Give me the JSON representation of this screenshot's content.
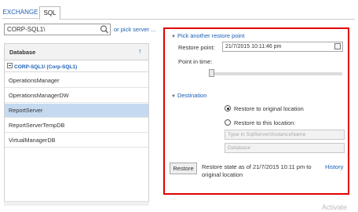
{
  "tabs": [
    {
      "label": "EXCHANGE"
    },
    {
      "label": "SQL"
    }
  ],
  "search": {
    "value": "CORP-SQL1\\",
    "pick_server_link": "or pick server ..."
  },
  "database_list": {
    "header": "Database",
    "group": "CORP-SQL1\\ (Corp-SQL1)",
    "items": [
      {
        "label": "OperationsManager"
      },
      {
        "label": "OperationsManagerDW"
      },
      {
        "label": "ReportServer"
      },
      {
        "label": "ReportServerTempDB"
      },
      {
        "label": "VirtualManagerDB"
      }
    ],
    "selected": "ReportServer"
  },
  "restore_point": {
    "section_title": "Pick another restore point",
    "restore_point_label": "Restore point:",
    "restore_point_value": "21/7/2015 10:11:46 pm",
    "point_in_time_label": "Point in time:",
    "slider_position": 0.0
  },
  "destination": {
    "section_title": "Destination",
    "option_original": "Restore to original location",
    "option_this": "Restore to this location:",
    "selected_option": "original",
    "instance_placeholder": "Type in SqlServer\\InstanceName",
    "database_placeholder": "Database"
  },
  "footer": {
    "restore_button": "Restore",
    "status_line1": "Restore state as of 21/7/2015 10:11 pm to",
    "status_line2": "original location",
    "history_link": "History"
  },
  "watermark": "Activate",
  "colors": {
    "accent": "#1a5fb4",
    "highlight_border": "#e00000",
    "selected_row": "#c5daf0"
  }
}
